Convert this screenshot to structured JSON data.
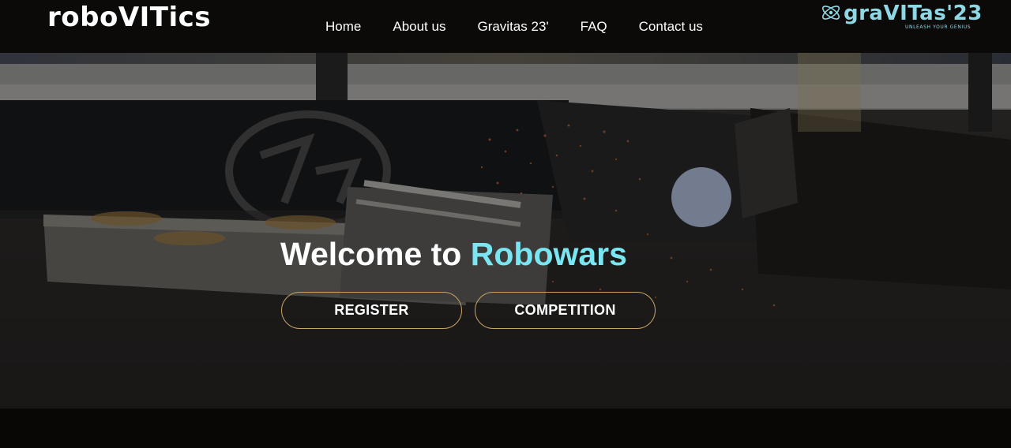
{
  "brand": {
    "name": "roboVITics"
  },
  "nav": {
    "items": [
      {
        "label": "Home"
      },
      {
        "label": "About us"
      },
      {
        "label": "Gravitas 23'"
      },
      {
        "label": "FAQ"
      },
      {
        "label": "Contact us"
      }
    ]
  },
  "partner": {
    "name": "graVITas'23",
    "tagline": "UNLEASH YOUR GENIUS",
    "icon": "atom-icon"
  },
  "hero": {
    "title_prefix": "Welcome to",
    "title_accent": "Robowars",
    "buttons": {
      "register": "REGISTER",
      "competition": "COMPETITION"
    }
  },
  "colors": {
    "accent": "#7ae6f2",
    "button_border": "#c9a467",
    "navbar": "#0b0a08",
    "partner": "#8ed8e6"
  }
}
